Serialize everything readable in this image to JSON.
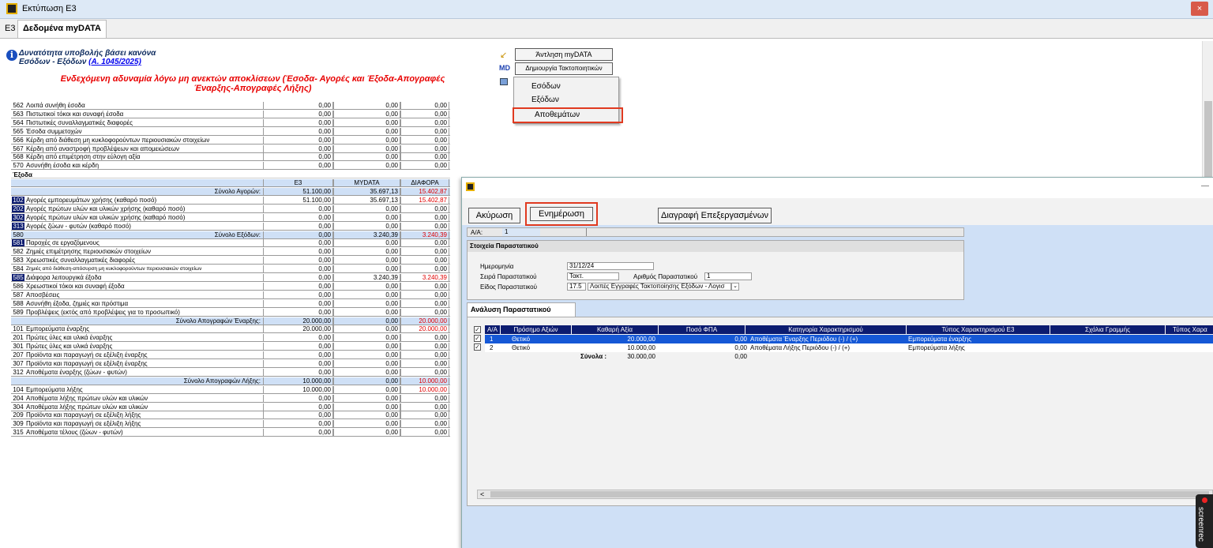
{
  "window": {
    "title": "Εκτύπωση Ε3",
    "close": "×"
  },
  "tabs": {
    "prefix": "Ε3",
    "active": "Δεδομένα myDATA"
  },
  "info": {
    "line1": "Δυνατότητα υποβολής βάσει κανόνα",
    "line2": "Εσόδων - Εξόδων",
    "link": "(Α. 1045/2025)",
    "icon": "info-icon"
  },
  "warning": {
    "line1": "Ενδεχόμενη αδυναμία λόγω μη ανεκτών αποκλίσεων (Έσοδα- Αγορές και Έξοδα-Απογραφές",
    "line2": "Έναρξης-Απογραφές Λήξης)"
  },
  "colors": {
    "accent": "#0c1c70",
    "highlight": "#e03a20",
    "negative": "#e00000",
    "selected": "#1558d6"
  },
  "main_rows": [
    {
      "type": "row",
      "code": "562",
      "label": "Λοιπά συνήθη έσοδα",
      "e3": "0,00",
      "mydata": "0,00",
      "diff": "0,00"
    },
    {
      "type": "row",
      "code": "563",
      "label": "Πιστωτικοί τόκοι και συναφή έσοδα",
      "e3": "0,00",
      "mydata": "0,00",
      "diff": "0,00"
    },
    {
      "type": "row",
      "code": "564",
      "label": "Πιστωτικές συναλλαγματικές διαφορές",
      "e3": "0,00",
      "mydata": "0,00",
      "diff": "0,00"
    },
    {
      "type": "row",
      "code": "565",
      "label": "Έσοδα συμμετοχών",
      "e3": "0,00",
      "mydata": "0,00",
      "diff": "0,00"
    },
    {
      "type": "row",
      "code": "566",
      "label": "Κέρδη από διάθεση μη κυκλοφορούντων περιουσιακών στοιχείων",
      "e3": "0,00",
      "mydata": "0,00",
      "diff": "0,00"
    },
    {
      "type": "row",
      "code": "567",
      "label": "Κέρδη από αναστροφή προβλέψεων και απομειώσεων",
      "e3": "0,00",
      "mydata": "0,00",
      "diff": "0,00"
    },
    {
      "type": "row",
      "code": "568",
      "label": "Κέρδη από επιμέτρηση στην εύλογη αξία",
      "e3": "0,00",
      "mydata": "0,00",
      "diff": "0,00"
    },
    {
      "type": "row",
      "code": "570",
      "label": "Ασυνήθη έσοδα και κέρδη",
      "e3": "0,00",
      "mydata": "0,00",
      "diff": "0,00"
    },
    {
      "type": "section",
      "label": "Έξοδα"
    },
    {
      "type": "header",
      "e3": "Ε3",
      "mydata": "MYDATA",
      "diff": "ΔΙΑΦΟΡΑ"
    },
    {
      "type": "subtotal",
      "label": "Σύνολο Αγορών:",
      "e3": "51.100,00",
      "mydata": "35.697,13",
      "diff": "15.402,87",
      "neg": true,
      "warn": true
    },
    {
      "type": "row",
      "code": "102",
      "dark": true,
      "label": "Αγορές εμπορευμάτων χρήσης (καθαρό ποσό)",
      "e3": "51.100,00",
      "mydata": "35.697,13",
      "diff": "15.402,87",
      "neg": true
    },
    {
      "type": "row",
      "code": "202",
      "dark": true,
      "label": "Αγορές πρώτων υλών και υλικών χρήσης (καθαρό ποσό)",
      "e3": "0,00",
      "mydata": "0,00",
      "diff": "0,00"
    },
    {
      "type": "row",
      "code": "302",
      "dark": true,
      "label": "Αγορές πρώτων υλών και υλικών χρήσης (καθαρό ποσό)",
      "e3": "0,00",
      "mydata": "0,00",
      "diff": "0,00"
    },
    {
      "type": "row",
      "code": "313",
      "dark": true,
      "label": "Αγορές ζώων - φυτών (καθαρό ποσό)",
      "e3": "0,00",
      "mydata": "0,00",
      "diff": "0,00"
    },
    {
      "type": "subtotal",
      "code": "580",
      "label": "Σύνολο Εξόδων:",
      "e3": "0,00",
      "mydata": "3.240,39",
      "diff": "3.240,39",
      "neg": true,
      "warn": true
    },
    {
      "type": "row",
      "code": "581",
      "dark": true,
      "label": "Παροχές σε εργαζόμενους",
      "e3": "0,00",
      "mydata": "0,00",
      "diff": "0,00"
    },
    {
      "type": "row",
      "code": "582",
      "label": "Ζημιές επιμέτρησης περιουσιακών στοιχείων",
      "e3": "0,00",
      "mydata": "0,00",
      "diff": "0,00"
    },
    {
      "type": "row",
      "code": "583",
      "label": "Χρεωστικές συναλλαγματικές διαφορές",
      "e3": "0,00",
      "mydata": "0,00",
      "diff": "0,00"
    },
    {
      "type": "row",
      "code": "584",
      "label": "Ζημιές από διάθεση-απόσυρση μη κυκλοφορούντων περιουσιακών στοιχείων",
      "tiny": true,
      "e3": "0,00",
      "mydata": "0,00",
      "diff": "0,00"
    },
    {
      "type": "row",
      "code": "585",
      "dark": true,
      "label": "Διάφορα λειτουργικά έξοδα",
      "e3": "0,00",
      "mydata": "3.240,39",
      "diff": "3.240,39",
      "neg": true
    },
    {
      "type": "row",
      "code": "586",
      "label": "Χρεωστικοί τόκοι και συναφή έξοδα",
      "e3": "0,00",
      "mydata": "0,00",
      "diff": "0,00"
    },
    {
      "type": "row",
      "code": "587",
      "label": "Αποσβέσεις",
      "e3": "0,00",
      "mydata": "0,00",
      "diff": "0,00"
    },
    {
      "type": "row",
      "code": "588",
      "label": "Ασυνήθη έξοδα, ζημιές και πρόστιμα",
      "e3": "0,00",
      "mydata": "0,00",
      "diff": "0,00"
    },
    {
      "type": "row",
      "code": "589",
      "label": "Προβλέψεις (εκτός από προβλέψεις για το προσωπικό)",
      "e3": "0,00",
      "mydata": "0,00",
      "diff": "0,00"
    },
    {
      "type": "subtotal",
      "label": "Σύνολο Απογραφών Έναρξης:",
      "e3": "20.000,00",
      "mydata": "0,00",
      "diff": "20.000,00",
      "neg": true,
      "warn": true
    },
    {
      "type": "row",
      "code": "101",
      "label": "Εμπορεύματα έναρξης",
      "e3": "20.000,00",
      "mydata": "0,00",
      "diff": "20.000,00",
      "neg": true
    },
    {
      "type": "row",
      "code": "201",
      "label": "Πρώτες ύλες και υλικά έναρξης",
      "e3": "0,00",
      "mydata": "0,00",
      "diff": "0,00"
    },
    {
      "type": "row",
      "code": "301",
      "label": "Πρώτες ύλες και υλικά έναρξης",
      "e3": "0,00",
      "mydata": "0,00",
      "diff": "0,00"
    },
    {
      "type": "row",
      "code": "207",
      "label": "Προϊόντα και παραγωγή σε εξέλιξη έναρξης",
      "e3": "0,00",
      "mydata": "0,00",
      "diff": "0,00"
    },
    {
      "type": "row",
      "code": "307",
      "label": "Προϊόντα και παραγωγή σε εξέλιξη έναρξης",
      "e3": "0,00",
      "mydata": "0,00",
      "diff": "0,00"
    },
    {
      "type": "row",
      "code": "312",
      "label": "Αποθέματα έναρξης (ζώων - φυτών)",
      "e3": "0,00",
      "mydata": "0,00",
      "diff": "0,00"
    },
    {
      "type": "subtotal",
      "label": "Σύνολο Απογραφών Λήξης:",
      "e3": "10.000,00",
      "mydata": "0,00",
      "diff": "10.000,00",
      "neg": true,
      "warn": true
    },
    {
      "type": "row",
      "code": "104",
      "label": "Εμπορεύματα λήξης",
      "e3": "10.000,00",
      "mydata": "0,00",
      "diff": "10.000,00",
      "neg": true
    },
    {
      "type": "row",
      "code": "204",
      "label": "Αποθέματα λήξης πρώτων υλών και υλικών",
      "e3": "0,00",
      "mydata": "0,00",
      "diff": "0,00"
    },
    {
      "type": "row",
      "code": "304",
      "label": "Αποθέματα λήξης πρώτων υλών και υλικών",
      "e3": "0,00",
      "mydata": "0,00",
      "diff": "0,00"
    },
    {
      "type": "row",
      "code": "209",
      "label": "Προϊόντα και παραγωγή σε εξέλιξη λήξης",
      "e3": "0,00",
      "mydata": "0,00",
      "diff": "0,00"
    },
    {
      "type": "row",
      "code": "309",
      "label": "Προϊόντα και παραγωγή σε εξέλιξη λήξης",
      "e3": "0,00",
      "mydata": "0,00",
      "diff": "0,00"
    },
    {
      "type": "row",
      "code": "315",
      "label": "Αποθέματα τέλους (ζώων - φυτών)",
      "e3": "0,00",
      "mydata": "0,00",
      "diff": "0,00"
    }
  ],
  "actions": {
    "antlisi": "Άντληση myDATA",
    "dimiourgia": "Δημιουργία Τακτοποιητικών",
    "md_glyph": "MD",
    "menu": {
      "esodon": "Εσόδων",
      "exodon": "Εξόδων",
      "apothematon": "Αποθεμάτων"
    }
  },
  "dialog": {
    "buttons": {
      "akyrosi": "Ακύρωση",
      "enimerosi": "Ενημέρωση",
      "diagrafi": "Διαγραφή Επεξεργασμένων"
    },
    "aa_label": "Α/Α:",
    "aa_value": "1",
    "stoixeia": {
      "title": "Στοιχεία Παραστατικού",
      "date_label": "Ημερομηνία",
      "date_value": "31/12/24",
      "seira_label": "Σειρά Παραστατικού",
      "seira_value": "Τακτ.",
      "arithmos_label": "Αριθμός Παραστατικού",
      "arithmos_value": "1",
      "eidos_label": "Είδος Παραστατικού",
      "eidos_code": "17.5",
      "eidos_value": "Λοιπές Εγγραφές Τακτοποίησης Εξόδων - Λογισ"
    },
    "analysi_tab": "Ανάλυση Παραστατικού",
    "grid": {
      "headers": [
        "Α/Α",
        "Πρόσημο Αξιών",
        "Καθαρή Αξία",
        "Ποσό ΦΠΑ",
        "Κατηγορία Χαρακτηρισμού",
        "Τύπος Χαρακτηρισμού Ε3",
        "Σχόλια Γραμμής",
        "Τύπος Χαρα"
      ],
      "rows": [
        {
          "aa": "1",
          "sign": "Θετικό",
          "net": "20.000,00",
          "vat": "0,00",
          "cat": "Αποθέματα Έναρξης Περιόδου (-) / (+)",
          "type": "Εμπορεύματα έναρξης"
        },
        {
          "aa": "2",
          "sign": "Θετικό",
          "net": "10.000,00",
          "vat": "0,00",
          "cat": "Αποθέματα Λήξης Περιόδου (-) / (+)",
          "type": "Εμπορεύματα λήξης"
        }
      ],
      "totals_label": "Σύνολα :",
      "totals_net": "30.000,00",
      "totals_vat": "0,00",
      "check": "✓",
      "scroll_left": "<"
    }
  },
  "recorder": {
    "text": "screenrec"
  }
}
